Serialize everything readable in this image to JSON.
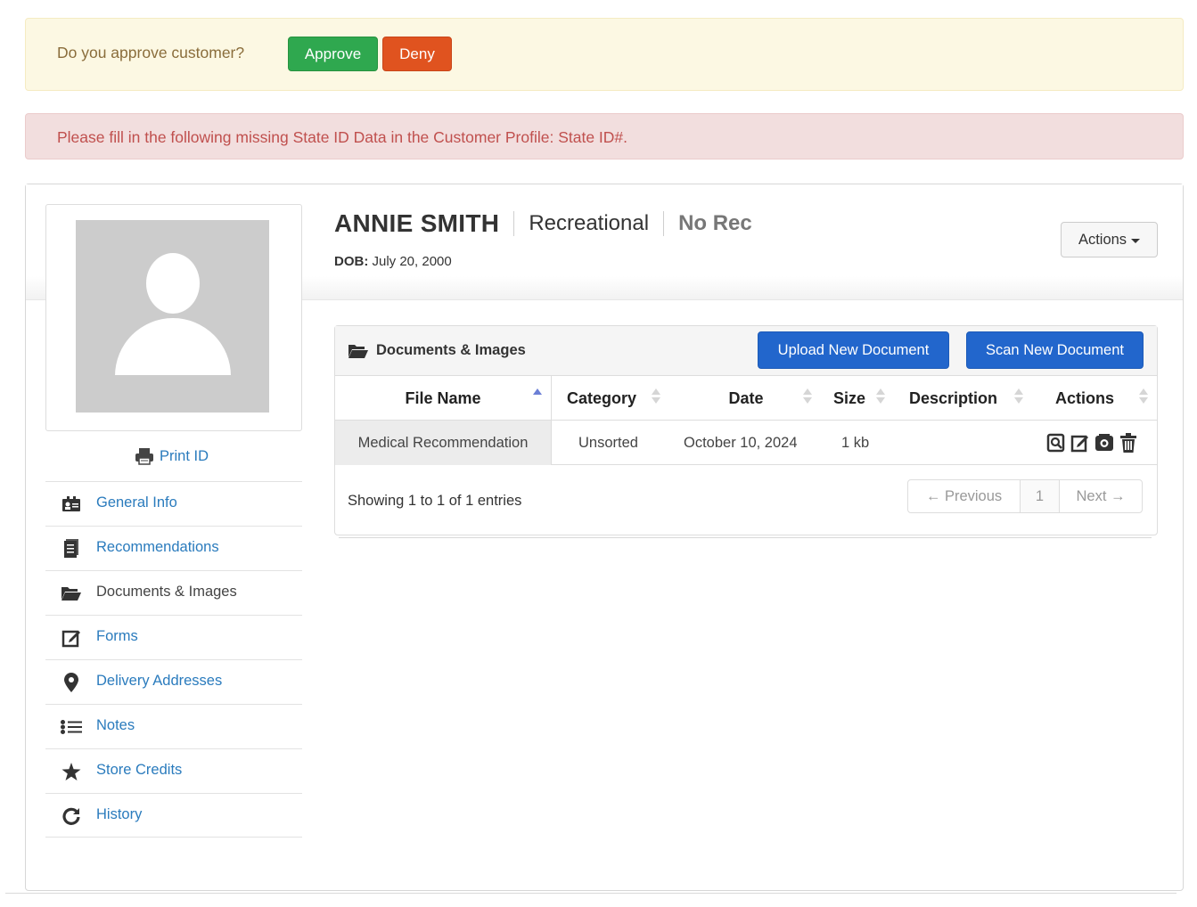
{
  "approval": {
    "question": "Do you approve customer?",
    "approve_label": "Approve",
    "deny_label": "Deny"
  },
  "missing_alert": "Please fill in the following missing State ID Data in the Customer Profile: State ID#.",
  "profile": {
    "name": "ANNIE SMITH",
    "customer_type": "Recreational",
    "rec_status": "No Rec",
    "dob_label": "DOB:",
    "dob_value": "July 20, 2000",
    "actions_label": "Actions",
    "print_id_label": "Print ID"
  },
  "sidebar": {
    "items": [
      {
        "label": "General Info",
        "icon": "id-card-icon",
        "active": false
      },
      {
        "label": "Recommendations",
        "icon": "document-icon",
        "active": false
      },
      {
        "label": "Documents & Images",
        "icon": "folder-open-icon",
        "active": true
      },
      {
        "label": "Forms",
        "icon": "edit-icon",
        "active": false
      },
      {
        "label": "Delivery Addresses",
        "icon": "map-marker-icon",
        "active": false
      },
      {
        "label": "Notes",
        "icon": "list-icon",
        "active": false
      },
      {
        "label": "Store Credits",
        "icon": "star-icon",
        "active": false
      },
      {
        "label": "History",
        "icon": "history-icon",
        "active": false
      }
    ]
  },
  "documents": {
    "title": "Documents & Images",
    "upload_label": "Upload New Document",
    "scan_label": "Scan New Document",
    "columns": [
      "File Name",
      "Category",
      "Date",
      "Size",
      "Description",
      "Actions"
    ],
    "sorted_column": "File Name",
    "rows": [
      {
        "file_name": "Medical Recommendation",
        "category": "Unsorted",
        "date": "October 10, 2024",
        "size": "1 kb",
        "description": ""
      }
    ],
    "row_action_icons": [
      "view-icon",
      "edit-icon",
      "scan-icon",
      "trash-icon"
    ],
    "showing": "Showing 1 to 1 of 1 entries",
    "pagination": {
      "previous": "← Previous",
      "page": "1",
      "next": "Next →"
    }
  },
  "colors": {
    "approve": "#2fa84f",
    "deny": "#e0531f",
    "primary": "#2266cc",
    "link": "#2a7bbd",
    "warning_bg": "#fcf8e3",
    "danger_bg": "#f2dede"
  }
}
